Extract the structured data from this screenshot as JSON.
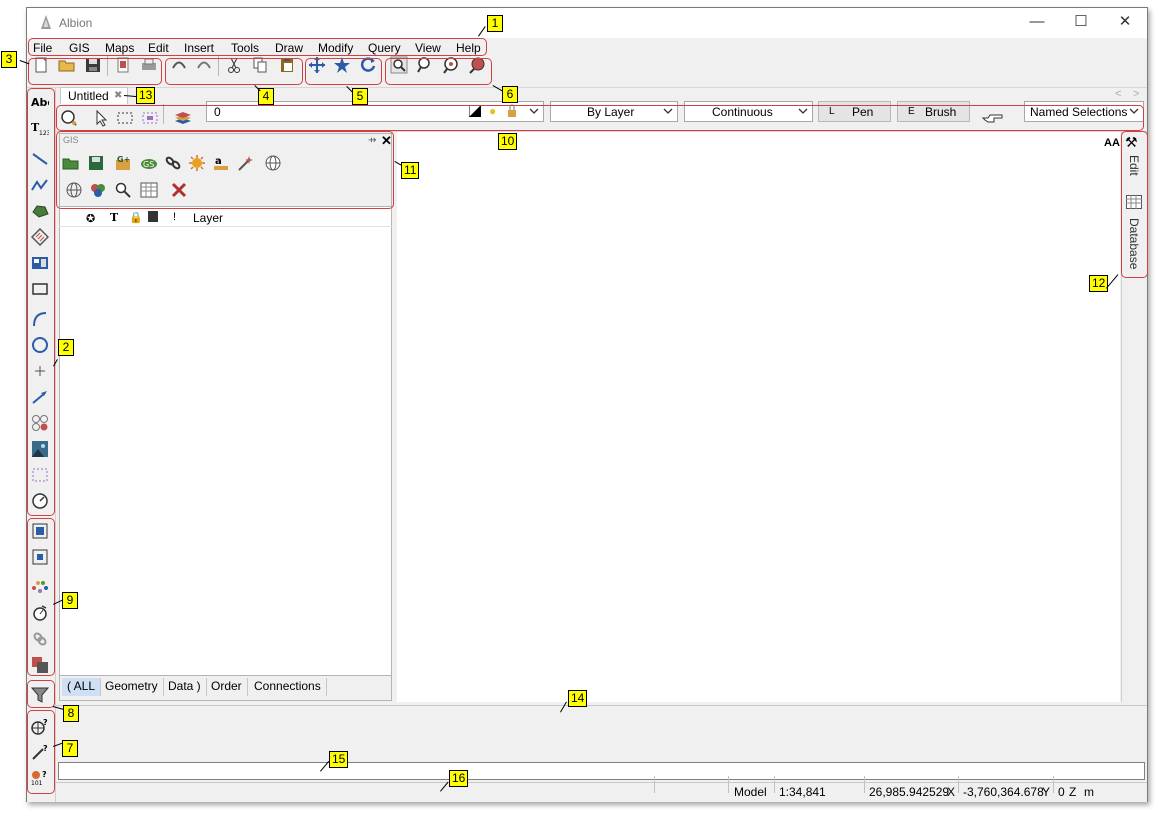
{
  "window": {
    "title": "Albion"
  },
  "menu": [
    "File",
    "GIS",
    "Maps",
    "Edit",
    "Insert",
    "Tools",
    "Draw",
    "Modify",
    "Query",
    "View",
    "Help"
  ],
  "document_tab": {
    "label": "Untitled"
  },
  "layer_bar": {
    "layer_value": "0",
    "color_value": "By Layer",
    "linetype_value": "Continuous",
    "pen": {
      "key": "L",
      "label": "Pen"
    },
    "brush": {
      "key": "E",
      "label": "Brush"
    },
    "named_selections": "Named Selections"
  },
  "gis_panel": {
    "title": "GIS",
    "column_header": "Layer",
    "tabs": [
      "( ALL",
      "Geometry",
      "Data )",
      "Order",
      "Connections"
    ]
  },
  "right_rail": {
    "edit_label": "Edit",
    "database_label": "Database",
    "font_icon_label": "AA"
  },
  "status": {
    "mode": "Model",
    "scale": "1:34,841",
    "x_value": "26,985.942529",
    "x_label": "X",
    "y_value": "-3,760,364.678",
    "y_label": "Y",
    "z_value": "0",
    "z_label": "Z",
    "unit": "m"
  },
  "annotations": [
    "1",
    "2",
    "3",
    "4",
    "5",
    "6",
    "7",
    "8",
    "9",
    "10",
    "11",
    "12",
    "13",
    "14",
    "15",
    "16"
  ],
  "colors": {
    "highlight": "#d04040",
    "badge": "#ffff00",
    "accent": "#2a5ca8"
  }
}
